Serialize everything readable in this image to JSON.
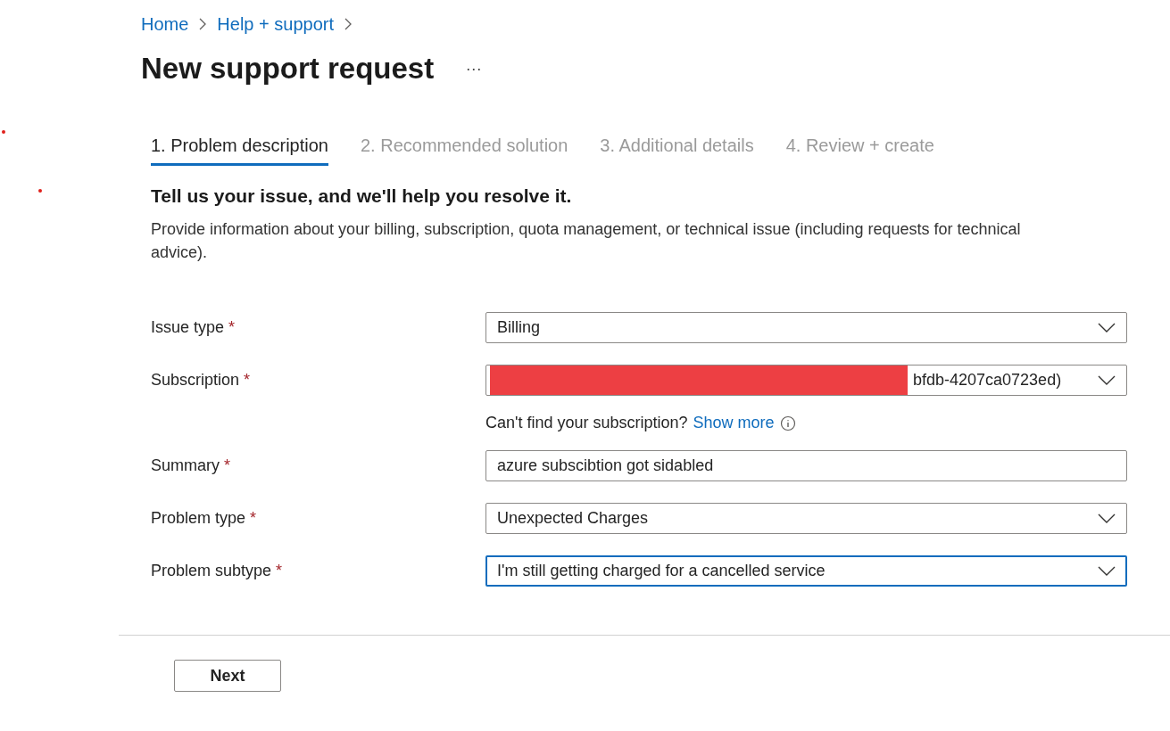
{
  "breadcrumb": [
    {
      "label": "Home"
    },
    {
      "label": "Help + support"
    }
  ],
  "title": "New support request",
  "more": "...",
  "tabs": [
    {
      "label": "1. Problem description",
      "selected": true
    },
    {
      "label": "2. Recommended solution",
      "selected": false
    },
    {
      "label": "3. Additional details",
      "selected": false
    },
    {
      "label": "4. Review + create",
      "selected": false
    }
  ],
  "heading": "Tell us your issue, and we'll help you resolve it.",
  "description": "Provide information about your billing, subscription, quota management, or technical issue (including requests for technical advice).",
  "fields": [
    {
      "kind": "dropdown",
      "label": "Issue type",
      "required_mark": "*",
      "value": "Billing",
      "focused": false
    },
    {
      "kind": "dropdown",
      "label": "Subscription",
      "required_mark": "*",
      "value": "bfdb-4207ca0723ed)",
      "focused": false,
      "redacted": true
    },
    {
      "kind": "hint",
      "text": "Can't find your subscription?",
      "link": "Show more"
    },
    {
      "kind": "text",
      "label": "Summary",
      "required_mark": "*",
      "value": "azure subscibtion got sidabled",
      "focused": false
    },
    {
      "kind": "dropdown",
      "label": "Problem type",
      "required_mark": "*",
      "value": "Unexpected Charges",
      "focused": false
    },
    {
      "kind": "dropdown",
      "label": "Problem subtype",
      "required_mark": "*",
      "value": "I'm still getting charged for a cancelled service",
      "focused": true
    }
  ],
  "next_button": "Next"
}
